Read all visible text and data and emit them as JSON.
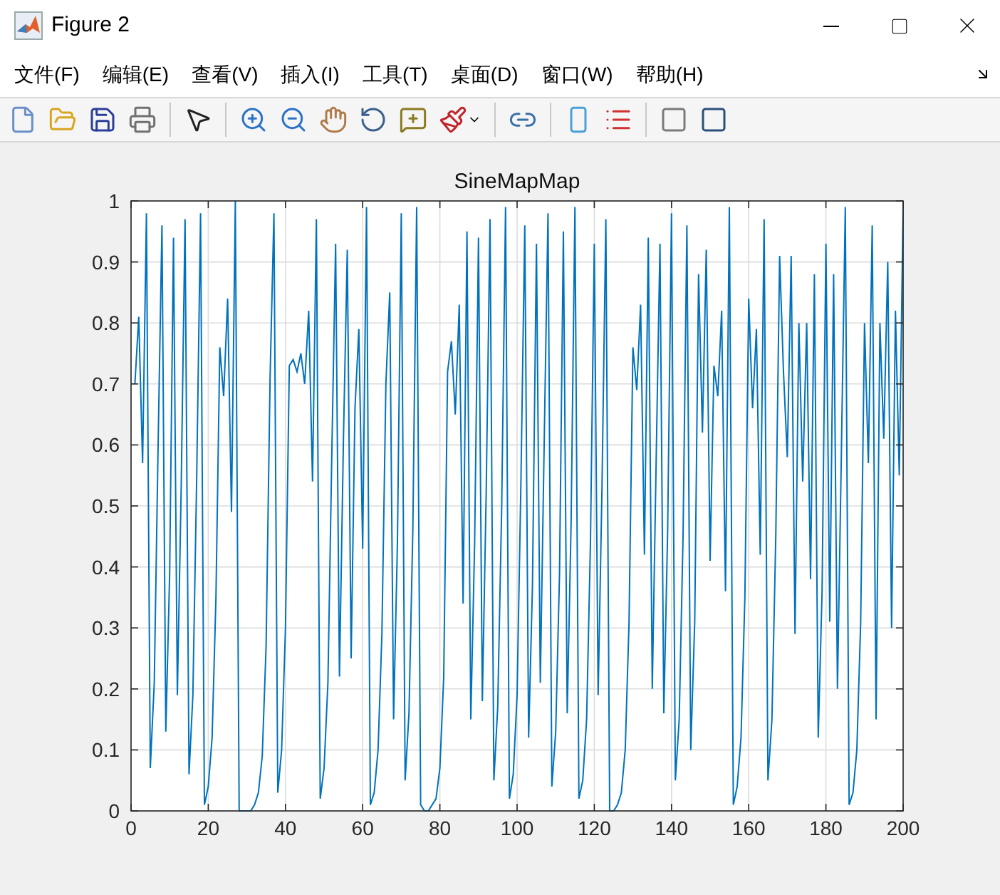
{
  "window": {
    "title": "Figure 2"
  },
  "menu": [
    {
      "label": "文件(F)"
    },
    {
      "label": "编辑(E)"
    },
    {
      "label": "查看(V)"
    },
    {
      "label": "插入(I)"
    },
    {
      "label": "工具(T)"
    },
    {
      "label": "桌面(D)"
    },
    {
      "label": "窗口(W)"
    },
    {
      "label": "帮助(H)"
    }
  ],
  "toolbar": [
    {
      "kind": "new"
    },
    {
      "kind": "open"
    },
    {
      "kind": "save"
    },
    {
      "kind": "print"
    },
    {
      "kind": "sep"
    },
    {
      "kind": "pointer"
    },
    {
      "kind": "sep"
    },
    {
      "kind": "zoomin"
    },
    {
      "kind": "zoomout"
    },
    {
      "kind": "pan"
    },
    {
      "kind": "rotate"
    },
    {
      "kind": "datatip"
    },
    {
      "kind": "brush"
    },
    {
      "kind": "sep"
    },
    {
      "kind": "link"
    },
    {
      "kind": "sep"
    },
    {
      "kind": "colorbar"
    },
    {
      "kind": "legend"
    },
    {
      "kind": "sep"
    },
    {
      "kind": "hide"
    },
    {
      "kind": "show"
    }
  ],
  "chart_data": {
    "type": "line",
    "title": "SineMapMap",
    "xlim": [
      0,
      200
    ],
    "ylim": [
      0,
      1
    ],
    "xticks": [
      0,
      20,
      40,
      60,
      80,
      100,
      120,
      140,
      160,
      180,
      200
    ],
    "yticks": [
      0,
      0.1,
      0.2,
      0.3,
      0.4,
      0.5,
      0.6,
      0.7,
      0.8,
      0.9,
      1
    ],
    "grid": true,
    "x": [
      1,
      2,
      3,
      4,
      5,
      6,
      7,
      8,
      9,
      10,
      11,
      12,
      13,
      14,
      15,
      16,
      17,
      18,
      19,
      20,
      21,
      22,
      23,
      24,
      25,
      26,
      27,
      28,
      29,
      30,
      31,
      32,
      33,
      34,
      35,
      36,
      37,
      38,
      39,
      40,
      41,
      42,
      43,
      44,
      45,
      46,
      47,
      48,
      49,
      50,
      51,
      52,
      53,
      54,
      55,
      56,
      57,
      58,
      59,
      60,
      61,
      62,
      63,
      64,
      65,
      66,
      67,
      68,
      69,
      70,
      71,
      72,
      73,
      74,
      75,
      76,
      77,
      78,
      79,
      80,
      81,
      82,
      83,
      84,
      85,
      86,
      87,
      88,
      89,
      90,
      91,
      92,
      93,
      94,
      95,
      96,
      97,
      98,
      99,
      100,
      101,
      102,
      103,
      104,
      105,
      106,
      107,
      108,
      109,
      110,
      111,
      112,
      113,
      114,
      115,
      116,
      117,
      118,
      119,
      120,
      121,
      122,
      123,
      124,
      125,
      126,
      127,
      128,
      129,
      130,
      131,
      132,
      133,
      134,
      135,
      136,
      137,
      138,
      139,
      140,
      141,
      142,
      143,
      144,
      145,
      146,
      147,
      148,
      149,
      150,
      151,
      152,
      153,
      154,
      155,
      156,
      157,
      158,
      159,
      160,
      161,
      162,
      163,
      164,
      165,
      166,
      167,
      168,
      169,
      170,
      171,
      172,
      173,
      174,
      175,
      176,
      177,
      178,
      179,
      180,
      181,
      182,
      183,
      184,
      185,
      186,
      187,
      188,
      189,
      190,
      191,
      192,
      193,
      194,
      195,
      196,
      197,
      198,
      199,
      200
    ],
    "series": [
      {
        "color": "#0072bd",
        "values": [
          0.7,
          0.81,
          0.57,
          0.98,
          0.07,
          0.21,
          0.6,
          0.96,
          0.13,
          0.39,
          0.94,
          0.19,
          0.53,
          0.97,
          0.06,
          0.19,
          0.55,
          0.98,
          0.01,
          0.04,
          0.12,
          0.35,
          0.76,
          0.68,
          0.84,
          0.49,
          1.0,
          0.0,
          0.0,
          0.0,
          0.0,
          0.01,
          0.03,
          0.09,
          0.27,
          0.71,
          0.98,
          0.03,
          0.1,
          0.3,
          0.73,
          0.74,
          0.72,
          0.75,
          0.7,
          0.82,
          0.54,
          0.97,
          0.02,
          0.07,
          0.21,
          0.58,
          0.93,
          0.22,
          0.61,
          0.92,
          0.25,
          0.66,
          0.79,
          0.43,
          0.99,
          0.01,
          0.03,
          0.1,
          0.29,
          0.7,
          0.85,
          0.15,
          0.44,
          0.98,
          0.05,
          0.16,
          0.46,
          0.99,
          0.01,
          0.0,
          0.0,
          0.01,
          0.02,
          0.07,
          0.22,
          0.72,
          0.77,
          0.65,
          0.83,
          0.34,
          0.95,
          0.15,
          0.44,
          0.94,
          0.18,
          0.52,
          0.97,
          0.05,
          0.17,
          0.5,
          0.99,
          0.02,
          0.06,
          0.19,
          0.54,
          0.96,
          0.12,
          0.37,
          0.93,
          0.21,
          0.6,
          0.98,
          0.04,
          0.13,
          0.39,
          0.95,
          0.16,
          0.47,
          0.99,
          0.02,
          0.05,
          0.15,
          0.44,
          0.93,
          0.19,
          0.53,
          0.97,
          0.0,
          0.0,
          0.01,
          0.03,
          0.1,
          0.31,
          0.76,
          0.69,
          0.83,
          0.42,
          0.94,
          0.2,
          0.57,
          0.93,
          0.16,
          0.46,
          0.98,
          0.05,
          0.15,
          0.45,
          0.96,
          0.1,
          0.31,
          0.88,
          0.62,
          0.92,
          0.41,
          0.73,
          0.68,
          0.82,
          0.36,
          0.99,
          0.01,
          0.04,
          0.12,
          0.35,
          0.84,
          0.66,
          0.79,
          0.42,
          0.97,
          0.05,
          0.15,
          0.45,
          0.91,
          0.72,
          0.58,
          0.91,
          0.29,
          0.8,
          0.54,
          0.8,
          0.38,
          0.88,
          0.12,
          0.36,
          0.93,
          0.31,
          0.88,
          0.2,
          0.58,
          0.99,
          0.01,
          0.03,
          0.1,
          0.31,
          0.8,
          0.57,
          0.96,
          0.15,
          0.8,
          0.61,
          0.9,
          0.3,
          0.82,
          0.55,
          0.99
        ]
      }
    ]
  }
}
